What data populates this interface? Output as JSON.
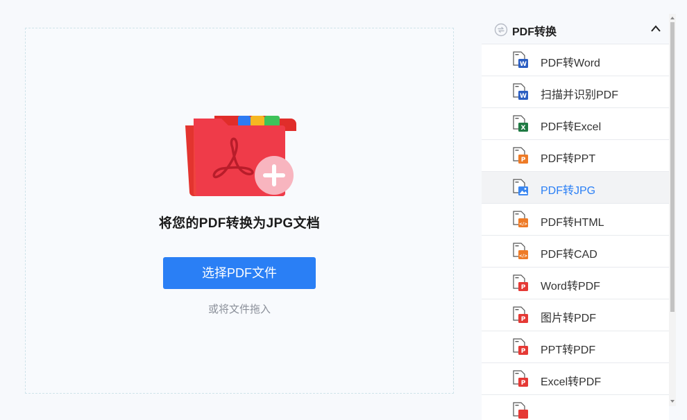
{
  "upload": {
    "title": "将您的PDF转换为JPG文档",
    "button_label": "选择PDF文件",
    "drag_hint": "或将文件拖入"
  },
  "sidebar": {
    "header": "PDF转换",
    "items": [
      {
        "label": "PDF转Word",
        "icon": "word-file-icon",
        "badge": "W",
        "color": "#2b5ec2"
      },
      {
        "label": "扫描并识别PDF",
        "icon": "scan-ocr-file-icon",
        "badge": "W",
        "color": "#2b5ec2"
      },
      {
        "label": "PDF转Excel",
        "icon": "excel-file-icon",
        "badge": "X",
        "color": "#1f7a43"
      },
      {
        "label": "PDF转PPT",
        "icon": "ppt-file-icon",
        "badge": "P",
        "color": "#ee7b27"
      },
      {
        "label": "PDF转JPG",
        "icon": "image-file-icon",
        "badge": "",
        "color": "#3a86f0",
        "active": true
      },
      {
        "label": "PDF转HTML",
        "icon": "html-file-icon",
        "badge": "</>",
        "color": "#ee7b27"
      },
      {
        "label": "PDF转CAD",
        "icon": "cad-file-icon",
        "badge": "</>",
        "color": "#ee7b27"
      },
      {
        "label": "Word转PDF",
        "icon": "pdf-file-icon",
        "badge": "P",
        "color": "#e53935"
      },
      {
        "label": "图片转PDF",
        "icon": "pdf-file-icon",
        "badge": "P",
        "color": "#e53935"
      },
      {
        "label": "PPT转PDF",
        "icon": "pdf-file-icon",
        "badge": "P",
        "color": "#e53935"
      },
      {
        "label": "Excel转PDF",
        "icon": "pdf-file-icon",
        "badge": "P",
        "color": "#e53935"
      },
      {
        "label": "",
        "icon": "pdf-file-icon",
        "badge": "",
        "color": "#e53935"
      }
    ]
  },
  "colors": {
    "accent": "#2a7ff5",
    "folder_red": "#f0433f",
    "plus_badge": "#f7a8b4"
  }
}
